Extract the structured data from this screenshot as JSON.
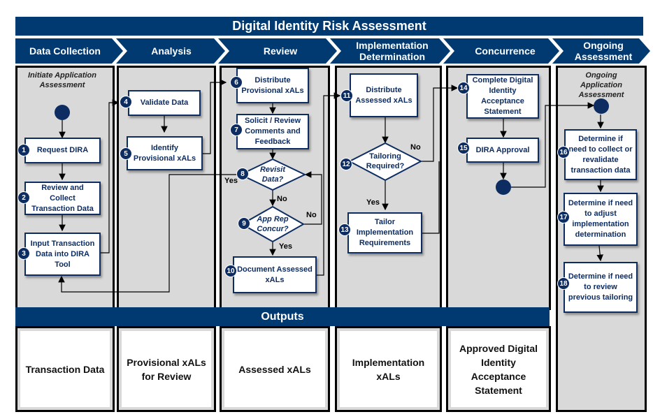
{
  "title": "Digital Identity Risk Assessment",
  "phases": [
    {
      "label": "Data Collection"
    },
    {
      "label": "Analysis"
    },
    {
      "label": "Review"
    },
    {
      "label": "Implementation Determination"
    },
    {
      "label": "Concurrence"
    },
    {
      "label": "Ongoing Assessment"
    }
  ],
  "start_labels": {
    "initiate": "Initiate Application Assessment",
    "ongoing": "Ongoing Application Assessment"
  },
  "steps": [
    {
      "num": "1",
      "text": "Request DIRA"
    },
    {
      "num": "2",
      "text": "Review and Collect Transaction Data"
    },
    {
      "num": "3",
      "text": "Input Transaction Data into DIRA Tool"
    },
    {
      "num": "4",
      "text": "Validate Data"
    },
    {
      "num": "5",
      "text": "Identify Provisional xALs"
    },
    {
      "num": "6",
      "text": "Distribute Provisional xALs"
    },
    {
      "num": "7",
      "text": "Solicit / Review Comments and Feedback"
    },
    {
      "num": "8",
      "text": "Revisit Data?"
    },
    {
      "num": "9",
      "text": "App Rep Concur?"
    },
    {
      "num": "10",
      "text": "Document Assessed xALs"
    },
    {
      "num": "11",
      "text": "Distribute Assessed xALs"
    },
    {
      "num": "12",
      "text": "Tailoring Required?"
    },
    {
      "num": "13",
      "text": "Tailor Implementation Requirements"
    },
    {
      "num": "14",
      "text": "Complete Digital Identity Acceptance Statement"
    },
    {
      "num": "15",
      "text": "DIRA Approval"
    },
    {
      "num": "16",
      "text": "Determine if need to collect or revalidate transaction data"
    },
    {
      "num": "17",
      "text": "Determine if need to adjust implementation determination"
    },
    {
      "num": "18",
      "text": "Determine if need to review previous tailoring"
    }
  ],
  "edge_labels": {
    "yes8": "Yes",
    "no8": "No",
    "no9": "No",
    "yes9": "Yes",
    "no12": "No",
    "yes12": "Yes"
  },
  "outputs": {
    "header": "Outputs",
    "items": [
      "Transaction Data",
      "Provisional xALs for Review",
      "Assessed xALs",
      "Implementation xALs",
      "Approved Digital Identity Acceptance Statement"
    ]
  },
  "colors": {
    "brand_navy": "#003a70",
    "node_navy": "#0d2d62",
    "lane_gray": "#d9d9d9"
  }
}
